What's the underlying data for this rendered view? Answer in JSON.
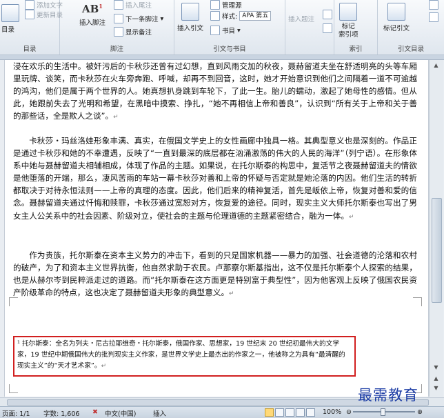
{
  "ribbon": {
    "toc": {
      "label": "目录",
      "update_label": "更新目录",
      "add_text_label": "添加文字",
      "group_label": "目录"
    },
    "footnote": {
      "ab_text": "AB",
      "ab_sup": "1",
      "insert_footnote": "插入脚注",
      "insert_endnote": "插入尾注",
      "next_footnote": "下一条脚注",
      "show_notes": "显示备注",
      "group_label": "脚注"
    },
    "citations": {
      "insert_citation": "插入引文",
      "manage_sources": "管理源",
      "style_label": "样式:",
      "style_value": "APA 第五",
      "bibliography": "书目",
      "group_label": "引文与书目"
    },
    "captions": {
      "insert_caption": "插入题注"
    },
    "index": {
      "mark_entry": "标记\n索引项",
      "group_label": "索引"
    },
    "toa": {
      "mark_citation": "标记引文",
      "group_label": "引文目录"
    }
  },
  "document": {
    "paragraphs": [
      "浸在欢乐的生活中。被奸污后的卡秋莎还曾有过幻想，直到风雨交加的秋夜，聂赫留道夫坐在舒适明亮的头等车厢里玩牌、谈笑，而卡秋莎在火车旁奔跑、呼喊，却再不到回音，这时，她才开始意识到他们之间隔着一道不可逾越的鸿沟，他们是属于两个世界的人。她真想扒身跳到车轮下，了此一生。胎儿的蠕动，激起了她母性的感情。但从此，她跟前失去了光明和希望，在黑暗中摸索、挣扎，“她不再相信上帝和善良”，认识到“所有关于上帝和关于善的那些话，全是欺人之谈”。",
      "卡秋莎・玛丝洛娃形象丰满、真实，在俄国文学史上的女性画廊中独具一格。其典型意义也是深刻的。作品正是通过卡秋莎和她的不幸遭遇，反映了“一直到最深的底层都在汹涌激荡的伟大的人民的海洋”（列宁语）。在形象体系中她与聂赫留道夫相辅相成，体现了作品的主题。如果说，在托尔斯泰的构思中，复活节之夜聂赫留道夫的情欲是他堕落的开端，那么，凄风苦雨的车站一幕卡秋莎对善和上帝的怀疑与否定就是她沦落的内因。他们生活的转折都取决于对待永恒法则——上帝的真理的态度。因此，他们后来的精神复活，首先是皈依上帝，恢复对善和爱的信念。聂赫留道夫通过忏悔和赎罪，卡秋莎通过宽恕对方，恢复爱的途径。同时，现实主义大师托尔斯泰也写出了男女主人公关系中的社会因素、阶级对立，使社会的主题与伦理道德的主题紧密结合，融为一体。",
      "作为贵族，托尔斯泰在资本主义势力的冲击下，看到的只是国家机器——暴力的加强、社会道德的沦落和农村的破产，为了和资本主义世界抗衡，他自然求助于农民。卢那察尔斯基指出，这不仅是托尔斯泰个人探索的结果，也是从赫尔岑到民粹派走过的道路。而“托尔斯泰在这方面更是特别富于典型性”，因为他客观上反映了俄国农民资产阶级革命的特点，这也决定了聂赫留道夫形象的典型意义。"
    ],
    "paragraph_mark": "↵",
    "footnote_text": "¹ 托尔斯泰：全名为列夫・尼古拉耶维奇・托尔斯泰，俄国作家、思想家，19 世纪末 20 世纪初最伟大的文学家，19 世纪中期俄国伟大的批判现实主义作家，是世界文学史上最杰出的作家之一，他被称之为具有“最清醒的现实主义”的“天才艺术家”。"
  },
  "statusbar": {
    "page": "页面: 1/1",
    "words": "字数: 1,606",
    "language": "中文(中国)",
    "mode": "插入",
    "zoom": "100%"
  },
  "watermark": "最需教育",
  "colors": {
    "footnote_border": "#d11f1f",
    "watermark": "#1f3fa6"
  }
}
